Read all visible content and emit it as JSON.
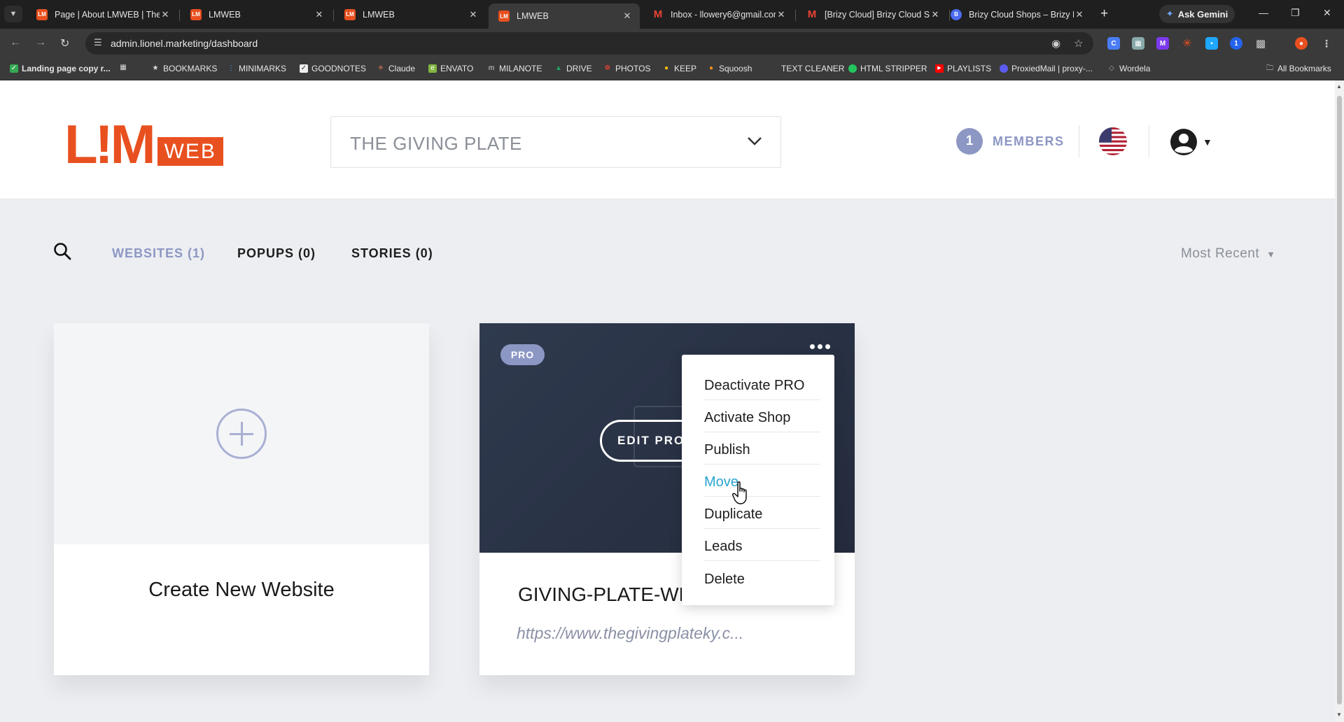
{
  "browser": {
    "tabs": [
      {
        "title": "Page | About LMWEB | The I",
        "favicon": "lm-icon",
        "active": false
      },
      {
        "title": "LMWEB",
        "favicon": "lm-icon",
        "active": false
      },
      {
        "title": "LMWEB",
        "favicon": "lm-icon",
        "active": false
      },
      {
        "title": "LMWEB",
        "favicon": "lm-icon",
        "active": true
      },
      {
        "title": "Inbox - llowery6@gmail.cor",
        "favicon": "gmail-icon",
        "active": false
      },
      {
        "title": "[Brizy Cloud] Brizy Cloud Sh",
        "favicon": "gmail-icon",
        "active": false
      },
      {
        "title": "Brizy Cloud Shops – Brizy H",
        "favicon": "brizy-icon",
        "active": false
      }
    ],
    "ask_gemini": "Ask Gemini",
    "url": "admin.lionel.marketing/dashboard",
    "bookmarks": [
      {
        "label": "Landing page copy r...",
        "icon": "check-icon",
        "color": "#34a853"
      },
      {
        "label": "",
        "icon": "apps-grid-icon",
        "color": "#3a3a3a"
      },
      {
        "label": "BOOKMARKS",
        "icon": "star-icon",
        "color": "#3a3a3a"
      },
      {
        "label": "MINIMARKS",
        "icon": "dots-icon",
        "color": "#4a8cff"
      },
      {
        "label": "GOODNOTES",
        "icon": "goodnotes-icon",
        "color": "#eeeeee"
      },
      {
        "label": "Claude",
        "icon": "claude-icon",
        "color": "#d97757"
      },
      {
        "label": "ENVATO",
        "icon": "envato-icon",
        "color": "#82b541"
      },
      {
        "label": "MILANOTE",
        "icon": "milanote-icon",
        "color": "#3a3a3a"
      },
      {
        "label": "DRIVE",
        "icon": "drive-icon",
        "color": "#1fa463"
      },
      {
        "label": "PHOTOS",
        "icon": "photos-icon",
        "color": "#ea4335"
      },
      {
        "label": "KEEP",
        "icon": "keep-icon",
        "color": "#fbbc04"
      },
      {
        "label": "Squoosh",
        "icon": "squoosh-icon",
        "color": "#f78f1e"
      },
      {
        "label": "TEXT CLEANER",
        "icon": "",
        "color": "#3a3a3a"
      },
      {
        "label": "HTML STRIPPER",
        "icon": "green-dot-icon",
        "color": "#22c55e"
      },
      {
        "label": "PLAYLISTS",
        "icon": "youtube-icon",
        "color": "#ff0000"
      },
      {
        "label": "ProxiedMail | proxy-...",
        "icon": "proxiedmail-icon",
        "color": "#5b5bf0"
      },
      {
        "label": "Wordela",
        "icon": "wordela-icon",
        "color": "#3a3a3a"
      }
    ],
    "all_bookmarks": "All Bookmarks"
  },
  "header": {
    "logo_main": "L!M",
    "logo_sub": "WEB",
    "project": "THE GIVING PLATE",
    "members_count": "1",
    "members_label": "MEMBERS"
  },
  "filters": {
    "tabs": [
      {
        "label": "WEBSITES (1)",
        "active": true
      },
      {
        "label": "POPUPS (0)",
        "active": false
      },
      {
        "label": "STORIES (0)",
        "active": false
      }
    ],
    "sort": "Most Recent"
  },
  "cards": {
    "create_label": "Create New Website",
    "site": {
      "badge": "PRO",
      "edit_label": "EDIT PROJECT",
      "name": "GIVING-PLATE-WEBSITE",
      "url": "https://www.thegivingplateky.c..."
    }
  },
  "menu": {
    "items": [
      {
        "label": "Deactivate PRO",
        "hover": false
      },
      {
        "label": "Activate Shop",
        "hover": false
      },
      {
        "label": "Publish",
        "hover": false
      },
      {
        "label": "Move",
        "hover": true
      },
      {
        "label": "Duplicate",
        "hover": false
      },
      {
        "label": "Leads",
        "hover": false
      },
      {
        "label": "Delete",
        "hover": false
      }
    ]
  },
  "colors": {
    "brand_orange": "#e8501f",
    "accent_purple": "#8d97c4",
    "menu_hover": "#2aa5cf"
  }
}
